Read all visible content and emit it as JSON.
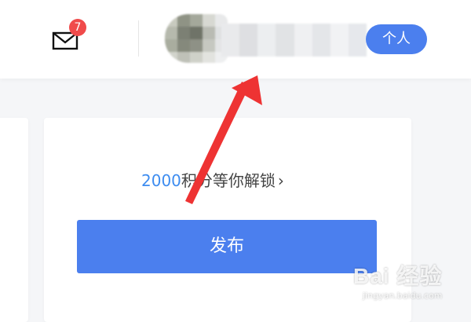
{
  "header": {
    "mail": {
      "icon": "mail-icon",
      "unread_count": "7"
    },
    "role_label": "个人"
  },
  "card": {
    "points_value": "2000",
    "points_text": "积分等你解锁",
    "chevron": "›",
    "publish_label": "发布"
  },
  "annotation": {
    "color": "#ee3333"
  },
  "watermark": {
    "logo": "Bai 经验",
    "url": "jingyan.baidu.com"
  },
  "colors": {
    "accent": "#4b7fee",
    "badge": "#f04a4a",
    "link_number": "#3d8cf0"
  }
}
